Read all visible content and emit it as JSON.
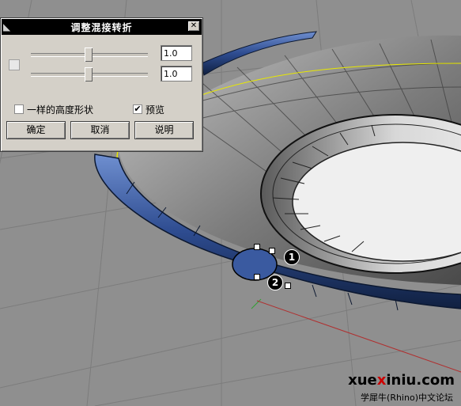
{
  "dialog": {
    "title": "调整混接转折",
    "slider1_value": "1.0",
    "slider2_value": "1.0",
    "same_height_label": "一样的高度形状",
    "same_height_checked": false,
    "preview_label": "预览",
    "preview_checked": true,
    "ok_label": "确定",
    "cancel_label": "取消",
    "help_label": "说明",
    "close_glyph": "✕"
  },
  "viewport": {
    "point_markers": [
      "1",
      "2"
    ],
    "colors": {
      "background": "#8f8f8f",
      "grid": "#7a7a7a",
      "surface_rim": "#2f4f8f",
      "surface_inner": "#6e6e6e",
      "edge_curve": "#e8e800",
      "x_axis": "#b03030",
      "y_axis": "#30a030"
    }
  },
  "watermark": {
    "site_prefix": "xue",
    "site_x": "x",
    "site_rest": "iniu.com",
    "subtitle": "学犀牛(Rhino)中文论坛"
  }
}
